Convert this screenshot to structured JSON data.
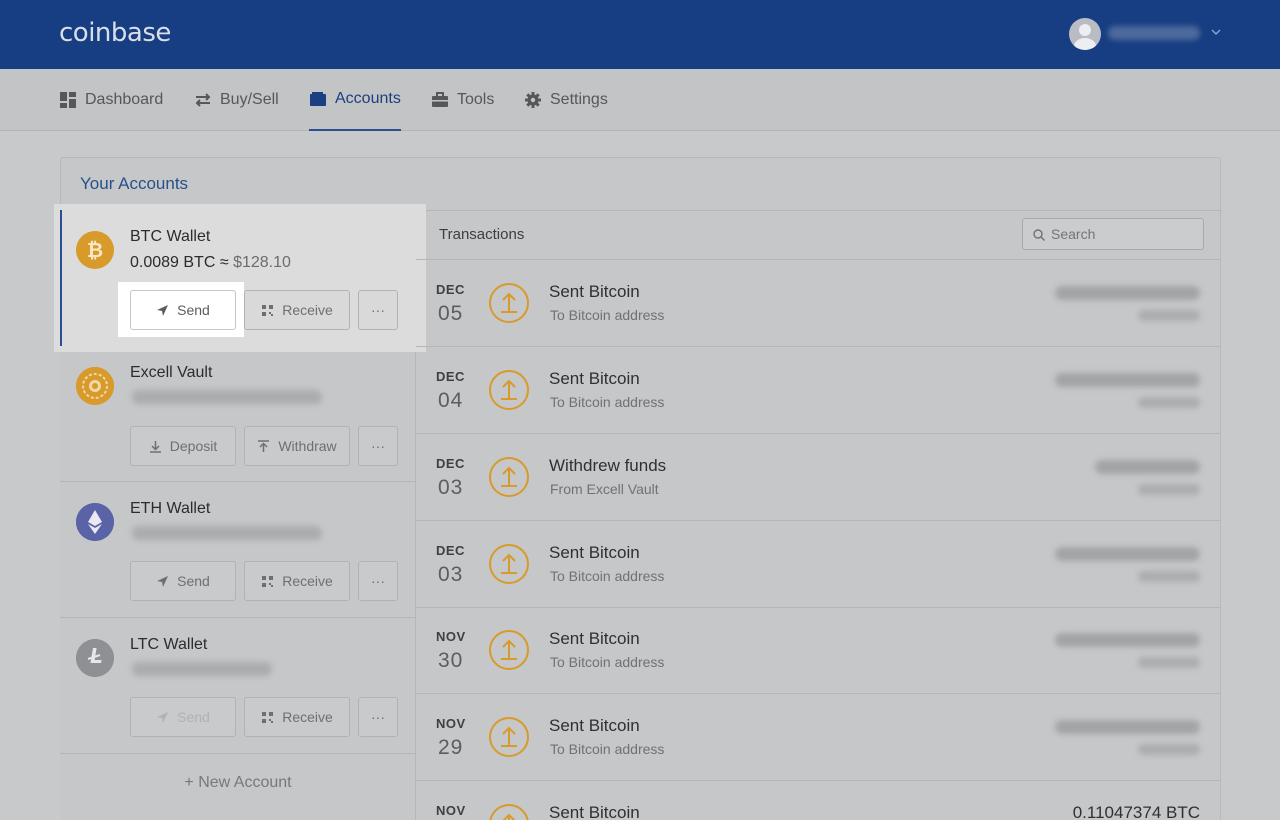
{
  "brand": {
    "logo": "coinbase"
  },
  "nav": {
    "items": [
      {
        "label": "Dashboard",
        "icon": "dashboard-icon"
      },
      {
        "label": "Buy/Sell",
        "icon": "swap-icon"
      },
      {
        "label": "Accounts",
        "icon": "wallet-icon",
        "active": true
      },
      {
        "label": "Tools",
        "icon": "toolbox-icon"
      },
      {
        "label": "Settings",
        "icon": "gear-icon"
      }
    ]
  },
  "panel": {
    "title": "Your Accounts"
  },
  "accounts": [
    {
      "name": "BTC Wallet",
      "balance_crypto": "0.0089 BTC ≈",
      "balance_usd": "$128.10",
      "icon": "bitcoin-icon",
      "color": "#d79a2b",
      "buttons": [
        "Send",
        "Receive",
        "···"
      ]
    },
    {
      "name": "Excell Vault",
      "icon": "vault-icon",
      "color": "#d79a2b",
      "buttons": [
        "Deposit",
        "Withdraw",
        "···"
      ]
    },
    {
      "name": "ETH Wallet",
      "icon": "ethereum-icon",
      "color": "#5a63a6",
      "buttons": [
        "Send",
        "Receive",
        "···"
      ]
    },
    {
      "name": "LTC Wallet",
      "icon": "litecoin-icon",
      "color": "#8e9093",
      "buttons": [
        "Send",
        "Receive",
        "···"
      ]
    }
  ],
  "new_account": "+ New Account",
  "transactions": {
    "title": "Transactions",
    "search_placeholder": "Search",
    "rows": [
      {
        "month": "DEC",
        "day": "05",
        "title": "Sent Bitcoin",
        "subtitle": "To Bitcoin address"
      },
      {
        "month": "DEC",
        "day": "04",
        "title": "Sent Bitcoin",
        "subtitle": "To Bitcoin address"
      },
      {
        "month": "DEC",
        "day": "03",
        "title": "Withdrew funds",
        "subtitle": "From Excell Vault"
      },
      {
        "month": "DEC",
        "day": "03",
        "title": "Sent Bitcoin",
        "subtitle": "To Bitcoin address"
      },
      {
        "month": "NOV",
        "day": "30",
        "title": "Sent Bitcoin",
        "subtitle": "To Bitcoin address"
      },
      {
        "month": "NOV",
        "day": "29",
        "title": "Sent Bitcoin",
        "subtitle": "To Bitcoin address"
      },
      {
        "month": "NOV",
        "day": "",
        "title": "Sent Bitcoin",
        "subtitle": "",
        "amount": "0.11047374 BTC"
      }
    ]
  },
  "colors": {
    "topbar": "#173e82",
    "accent": "#27508c",
    "tx_icon": "#d79a2b"
  }
}
